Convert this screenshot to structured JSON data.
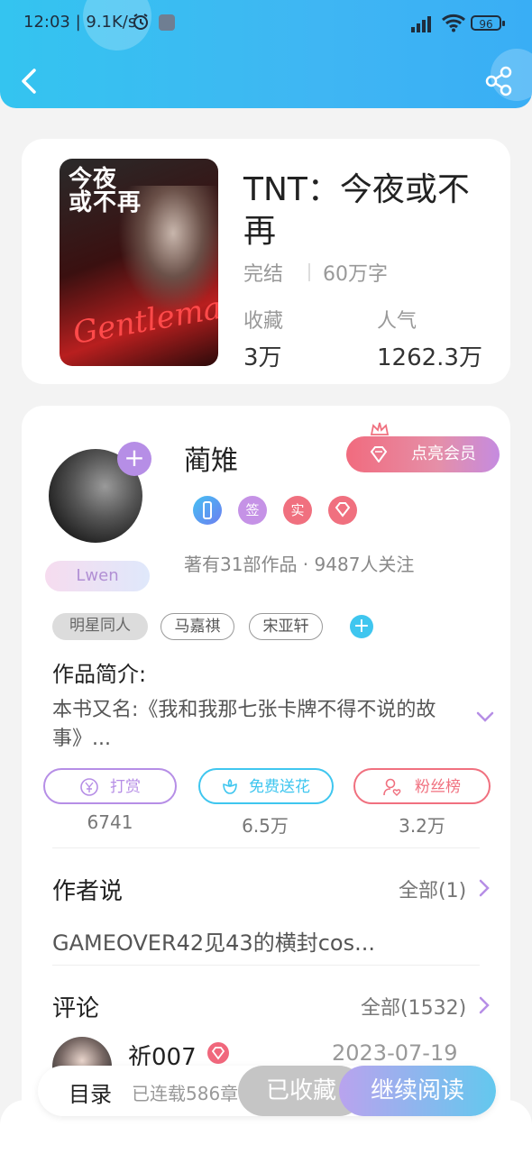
{
  "status_bar": {
    "time": "12:03 | 9.1K/s",
    "battery": "96"
  },
  "book": {
    "cover_title": "今夜\n或不再",
    "cover_script": "Gentleman",
    "title": "TNT：今夜或不再",
    "status": "完结",
    "words": "60万字",
    "favorites_label": "收藏",
    "favorites_value": "3万",
    "popularity_label": "人气",
    "popularity_value": "1262.3万"
  },
  "author": {
    "name": "蔺雉",
    "sub_tag": "Lwen",
    "vip_button": "点亮会员",
    "badges": {
      "sign": "签",
      "real": "实"
    },
    "meta": "著有31部作品 · 9487人关注",
    "tags": [
      "明星同人",
      "马嘉祺",
      "宋亚轩"
    ]
  },
  "intro": {
    "title": "作品简介:",
    "text": "本书又名:《我和我那七张卡牌不得不说的故事》..."
  },
  "actions": [
    {
      "label": "打赏",
      "count": "6741",
      "color": "#b68ee6"
    },
    {
      "label": "免费送花",
      "count": "6.5万",
      "color": "#3fc6ef"
    },
    {
      "label": "粉丝榜",
      "count": "3.2万",
      "color": "#f0707f"
    }
  ],
  "author_says": {
    "title": "作者说",
    "more": "全部(1)",
    "content": "GAMEOVER42见43的横封cos..."
  },
  "comments": {
    "title": "评论",
    "more": "全部(1532)",
    "first": {
      "user": "祈007",
      "date": "2023-07-19"
    }
  },
  "bottom_bar": {
    "catalog": "目录",
    "serial": "已连载586章",
    "collected": "已收藏",
    "continue": "继续阅读"
  }
}
